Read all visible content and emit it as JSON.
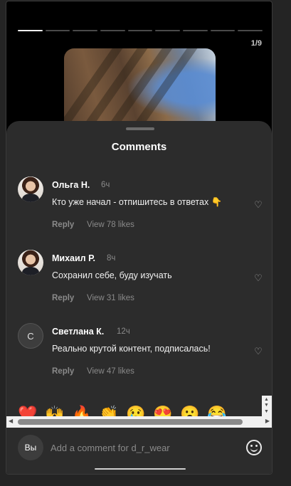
{
  "story": {
    "segments": 9,
    "active_segment": 1,
    "counter": "1/9"
  },
  "sheet": {
    "title": "Comments"
  },
  "comments": [
    {
      "author": "Ольга Н.",
      "time": "6ч",
      "text": "Кто уже начал - отпишитесь в ответах 👇",
      "reply_label": "Reply",
      "likes_label": "View 78 likes",
      "avatar": "photo"
    },
    {
      "author": "Михаил Р.",
      "time": "8ч",
      "text": "Сохранил себе, буду изучать",
      "reply_label": "Reply",
      "likes_label": "View 31 likes",
      "avatar": "photo"
    },
    {
      "author": "Светлана К.",
      "time": "12ч",
      "text": "Реально крутой контент, подписалась!",
      "reply_label": "Reply",
      "likes_label": "View 47 likes",
      "avatar_initial": "С"
    }
  ],
  "emoji_bar": [
    "❤️",
    "🙌",
    "🔥",
    "👏",
    "😢",
    "😍",
    "😮",
    "😂"
  ],
  "composer": {
    "avatar_label": "Вы",
    "placeholder": "Add a comment for d_r_wear"
  },
  "icons": {
    "like": "heart-outline-icon",
    "emoji": "smiley-icon"
  }
}
